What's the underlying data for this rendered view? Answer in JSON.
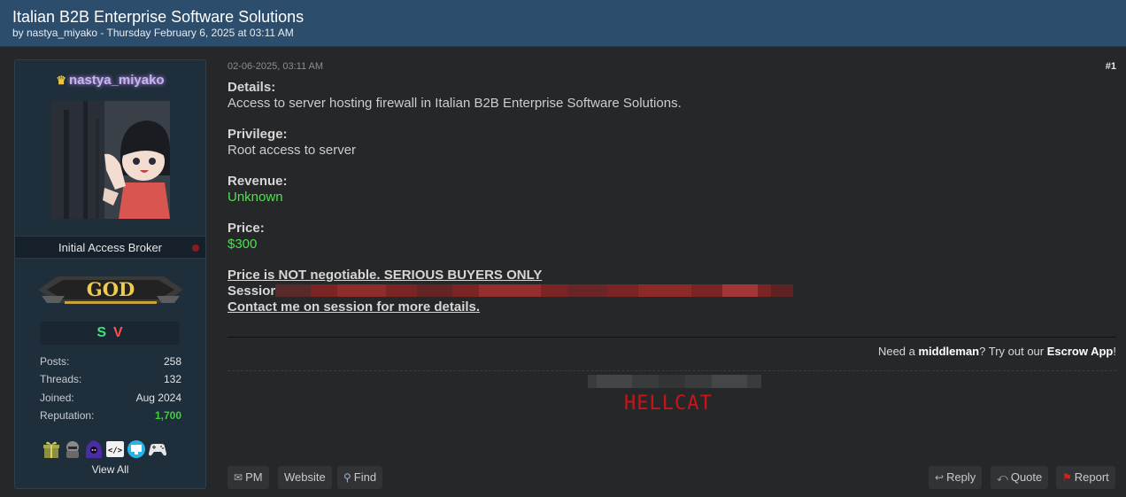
{
  "thread": {
    "title": "Italian B2B Enterprise Software Solutions",
    "byline": "by nastya_miyako - Thursday February 6, 2025 at 03:11 AM"
  },
  "author": {
    "username": "nastya_miyako",
    "rank": "Initial Access Broker",
    "badge_text": "GOD",
    "badge_icons": [
      "S",
      "V"
    ],
    "stats": [
      {
        "label": "Posts:",
        "value": "258"
      },
      {
        "label": "Threads:",
        "value": "132"
      },
      {
        "label": "Joined:",
        "value": "Aug 2024"
      },
      {
        "label": "Reputation:",
        "value": "1,700"
      }
    ],
    "awards": [
      "gift-icon",
      "helmet-icon",
      "hooded-icon",
      "code-icon",
      "monitor-icon",
      "gamepad-icon"
    ],
    "view_all": "View All"
  },
  "post": {
    "date": "02-06-2025, 03:11 AM",
    "number": "#1",
    "details_label": "Details:",
    "details_text": "Access to server hosting firewall in Italian B2B Enterprise Software Solutions.",
    "privilege_label": "Privilege:",
    "privilege_text": "Root access to server",
    "revenue_label": "Revenue:",
    "revenue_text": "Unknown",
    "price_label": "Price:",
    "price_text": "$300",
    "notice_1": "Price is NOT negotiable. SERIOUS BUYERS ONLY",
    "session_label": "Sessior",
    "notice_2": "Contact me on session for more details."
  },
  "signature": {
    "middleman_pre": "Need a ",
    "middleman_bold": "middleman",
    "middleman_mid": "? Try out our ",
    "middleman_app": "Escrow App",
    "middleman_end": "!",
    "sig_text": "HELLCAT"
  },
  "actions": {
    "pm": "PM",
    "website": "Website",
    "find": "Find",
    "reply": "Reply",
    "quote": "Quote",
    "report": "Report"
  },
  "colors": {
    "header_bg": "#2c4d6c",
    "username": "#c8b2f2",
    "green": "#4ee04e",
    "hellcat": "#cc1414"
  }
}
